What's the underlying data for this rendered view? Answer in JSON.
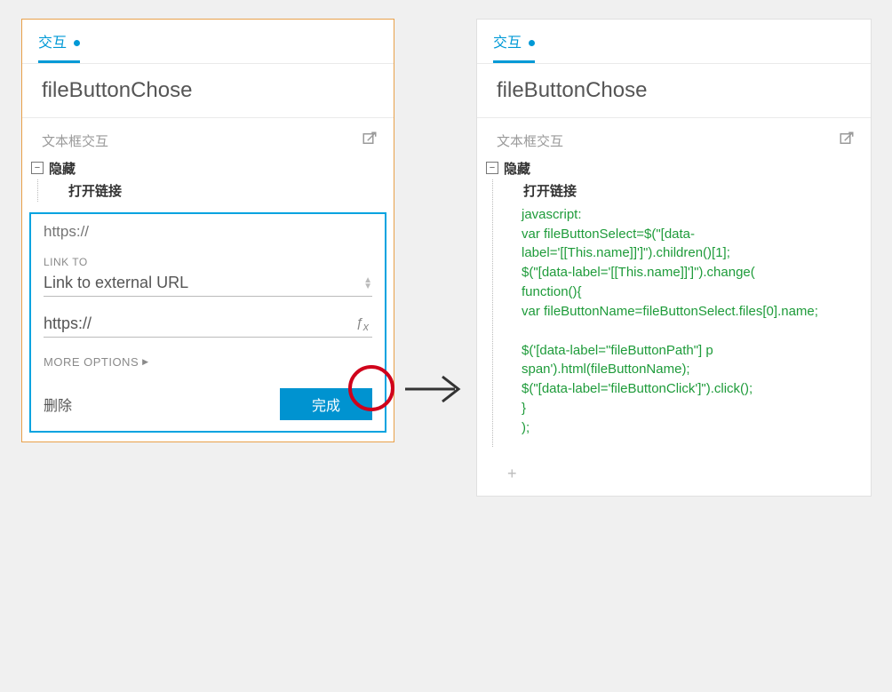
{
  "left": {
    "tab": "交互",
    "title": "fileButtonChose",
    "section_label": "文本框交互",
    "tree": {
      "root": "隐藏",
      "child": "打开链接"
    },
    "form": {
      "placeholder": "https://",
      "link_to_label": "LINK TO",
      "link_to_value": "Link to external URL",
      "url_value": "https://",
      "more_options": "MORE OPTIONS",
      "delete_label": "删除",
      "done_label": "完成"
    }
  },
  "right": {
    "tab": "交互",
    "title": "fileButtonChose",
    "section_label": "文本框交互",
    "tree": {
      "root": "隐藏",
      "child": "打开链接"
    },
    "code": [
      "javascript:",
      "var fileButtonSelect=$(\"[data-label='[[This.name]]']\").children()[1];",
      "$(\"[data-label='[[This.name]]']\").change(",
      "function(){",
      "var fileButtonName=fileButtonSelect.files[0].name;",
      "",
      "$('[data-label=\"fileButtonPath\"] p span').html(fileButtonName);",
      "$(\"[data-label='fileButtonClick']\").click();",
      " }",
      ");"
    ],
    "add": "+"
  }
}
